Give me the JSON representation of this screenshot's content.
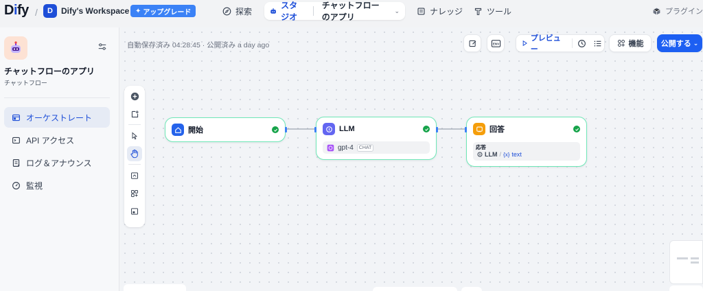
{
  "header": {
    "logo": {
      "pre": "D",
      "mid": "i",
      "post": "fy"
    },
    "workspace": {
      "initial": "D",
      "name": "Dify's Workspace"
    },
    "upgrade_label": "アップグレード",
    "nav": {
      "explore": "探索",
      "studio": "スタジオ",
      "current_app": "チャットフローのアプリ",
      "knowledge": "ナレッジ",
      "tools": "ツール",
      "plugins": "プラグイン"
    }
  },
  "sidebar": {
    "app_name": "チャットフローのアプリ",
    "app_type": "チャットフロー",
    "items": [
      {
        "label": "オーケストレート",
        "icon": "layout-icon",
        "active": true
      },
      {
        "label": "API アクセス",
        "icon": "terminal-icon",
        "active": false
      },
      {
        "label": "ログ＆アナウンス",
        "icon": "log-icon",
        "active": false
      },
      {
        "label": "監視",
        "icon": "gauge-icon",
        "active": false
      }
    ]
  },
  "canvas": {
    "autosave": "自動保存済み 04:28:45 · 公開済み a day ago",
    "toolbar": {
      "preview": "プレビュー",
      "features": "機能",
      "publish": "公開する"
    },
    "nodes": [
      {
        "title": "開始"
      },
      {
        "title": "LLM",
        "model": "gpt-4",
        "badge": "CHAT"
      },
      {
        "title": "回答",
        "field_label": "応答",
        "ref_node": "LLM",
        "ref_var": "text",
        "ref_var_prefix": "{x}"
      }
    ]
  },
  "colors": {
    "accent": "#1d5ff2",
    "node_border": "#6ee7b7",
    "success": "#16a34a"
  }
}
